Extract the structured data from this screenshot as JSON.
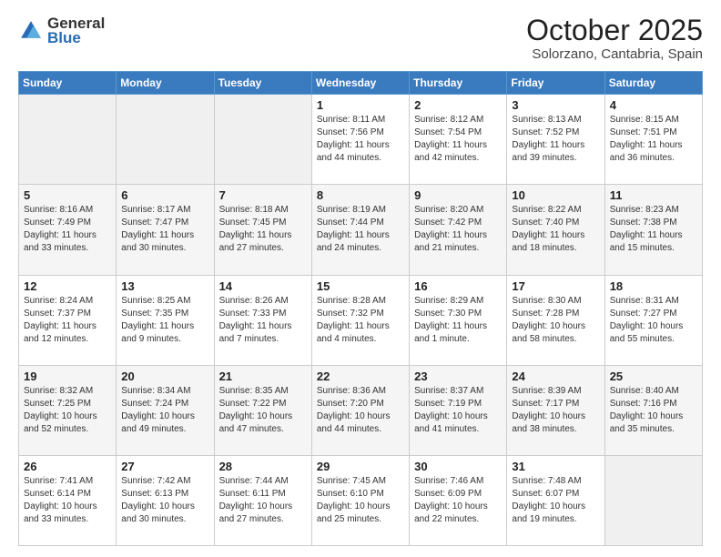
{
  "header": {
    "logo_general": "General",
    "logo_blue": "Blue",
    "month_title": "October 2025",
    "subtitle": "Solorzano, Cantabria, Spain"
  },
  "days_of_week": [
    "Sunday",
    "Monday",
    "Tuesday",
    "Wednesday",
    "Thursday",
    "Friday",
    "Saturday"
  ],
  "weeks": [
    [
      {
        "day": "",
        "info": ""
      },
      {
        "day": "",
        "info": ""
      },
      {
        "day": "",
        "info": ""
      },
      {
        "day": "1",
        "info": "Sunrise: 8:11 AM\nSunset: 7:56 PM\nDaylight: 11 hours and 44 minutes."
      },
      {
        "day": "2",
        "info": "Sunrise: 8:12 AM\nSunset: 7:54 PM\nDaylight: 11 hours and 42 minutes."
      },
      {
        "day": "3",
        "info": "Sunrise: 8:13 AM\nSunset: 7:52 PM\nDaylight: 11 hours and 39 minutes."
      },
      {
        "day": "4",
        "info": "Sunrise: 8:15 AM\nSunset: 7:51 PM\nDaylight: 11 hours and 36 minutes."
      }
    ],
    [
      {
        "day": "5",
        "info": "Sunrise: 8:16 AM\nSunset: 7:49 PM\nDaylight: 11 hours and 33 minutes."
      },
      {
        "day": "6",
        "info": "Sunrise: 8:17 AM\nSunset: 7:47 PM\nDaylight: 11 hours and 30 minutes."
      },
      {
        "day": "7",
        "info": "Sunrise: 8:18 AM\nSunset: 7:45 PM\nDaylight: 11 hours and 27 minutes."
      },
      {
        "day": "8",
        "info": "Sunrise: 8:19 AM\nSunset: 7:44 PM\nDaylight: 11 hours and 24 minutes."
      },
      {
        "day": "9",
        "info": "Sunrise: 8:20 AM\nSunset: 7:42 PM\nDaylight: 11 hours and 21 minutes."
      },
      {
        "day": "10",
        "info": "Sunrise: 8:22 AM\nSunset: 7:40 PM\nDaylight: 11 hours and 18 minutes."
      },
      {
        "day": "11",
        "info": "Sunrise: 8:23 AM\nSunset: 7:38 PM\nDaylight: 11 hours and 15 minutes."
      }
    ],
    [
      {
        "day": "12",
        "info": "Sunrise: 8:24 AM\nSunset: 7:37 PM\nDaylight: 11 hours and 12 minutes."
      },
      {
        "day": "13",
        "info": "Sunrise: 8:25 AM\nSunset: 7:35 PM\nDaylight: 11 hours and 9 minutes."
      },
      {
        "day": "14",
        "info": "Sunrise: 8:26 AM\nSunset: 7:33 PM\nDaylight: 11 hours and 7 minutes."
      },
      {
        "day": "15",
        "info": "Sunrise: 8:28 AM\nSunset: 7:32 PM\nDaylight: 11 hours and 4 minutes."
      },
      {
        "day": "16",
        "info": "Sunrise: 8:29 AM\nSunset: 7:30 PM\nDaylight: 11 hours and 1 minute."
      },
      {
        "day": "17",
        "info": "Sunrise: 8:30 AM\nSunset: 7:28 PM\nDaylight: 10 hours and 58 minutes."
      },
      {
        "day": "18",
        "info": "Sunrise: 8:31 AM\nSunset: 7:27 PM\nDaylight: 10 hours and 55 minutes."
      }
    ],
    [
      {
        "day": "19",
        "info": "Sunrise: 8:32 AM\nSunset: 7:25 PM\nDaylight: 10 hours and 52 minutes."
      },
      {
        "day": "20",
        "info": "Sunrise: 8:34 AM\nSunset: 7:24 PM\nDaylight: 10 hours and 49 minutes."
      },
      {
        "day": "21",
        "info": "Sunrise: 8:35 AM\nSunset: 7:22 PM\nDaylight: 10 hours and 47 minutes."
      },
      {
        "day": "22",
        "info": "Sunrise: 8:36 AM\nSunset: 7:20 PM\nDaylight: 10 hours and 44 minutes."
      },
      {
        "day": "23",
        "info": "Sunrise: 8:37 AM\nSunset: 7:19 PM\nDaylight: 10 hours and 41 minutes."
      },
      {
        "day": "24",
        "info": "Sunrise: 8:39 AM\nSunset: 7:17 PM\nDaylight: 10 hours and 38 minutes."
      },
      {
        "day": "25",
        "info": "Sunrise: 8:40 AM\nSunset: 7:16 PM\nDaylight: 10 hours and 35 minutes."
      }
    ],
    [
      {
        "day": "26",
        "info": "Sunrise: 7:41 AM\nSunset: 6:14 PM\nDaylight: 10 hours and 33 minutes."
      },
      {
        "day": "27",
        "info": "Sunrise: 7:42 AM\nSunset: 6:13 PM\nDaylight: 10 hours and 30 minutes."
      },
      {
        "day": "28",
        "info": "Sunrise: 7:44 AM\nSunset: 6:11 PM\nDaylight: 10 hours and 27 minutes."
      },
      {
        "day": "29",
        "info": "Sunrise: 7:45 AM\nSunset: 6:10 PM\nDaylight: 10 hours and 25 minutes."
      },
      {
        "day": "30",
        "info": "Sunrise: 7:46 AM\nSunset: 6:09 PM\nDaylight: 10 hours and 22 minutes."
      },
      {
        "day": "31",
        "info": "Sunrise: 7:48 AM\nSunset: 6:07 PM\nDaylight: 10 hours and 19 minutes."
      },
      {
        "day": "",
        "info": ""
      }
    ]
  ]
}
